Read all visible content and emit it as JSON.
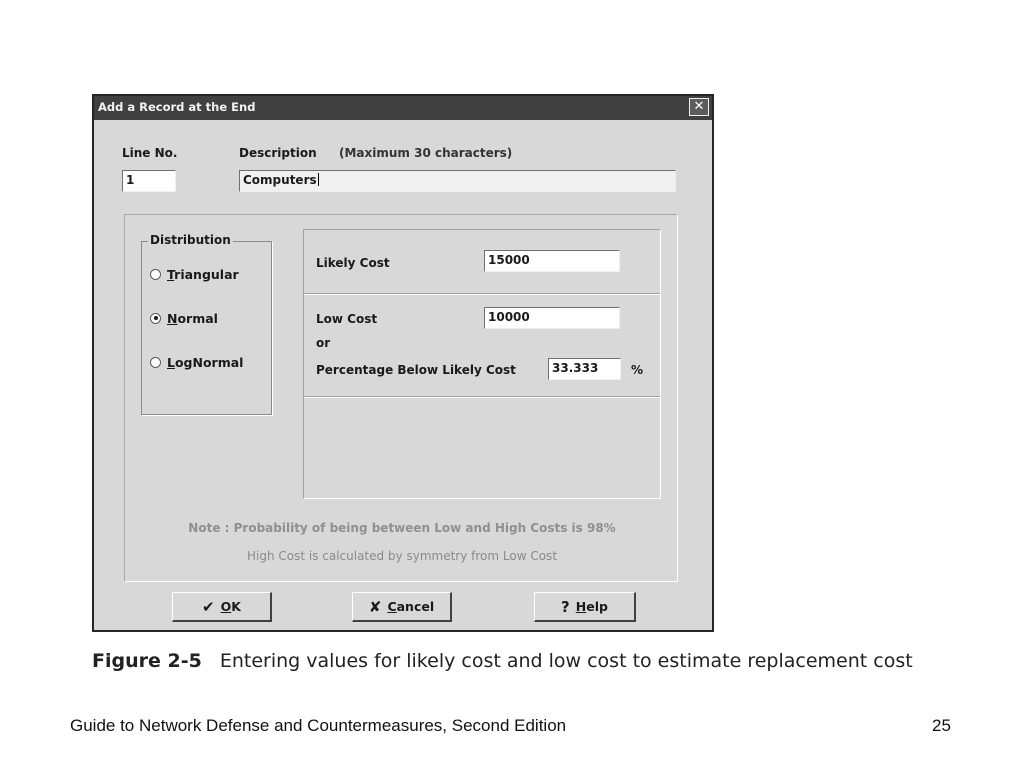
{
  "dialog": {
    "title": "Add a Record at the End",
    "close_glyph": "✕",
    "line_no_label": "Line No.",
    "line_no_value": "1",
    "description_label": "Description",
    "description_hint": "(Maximum 30 characters)",
    "description_value": "Computers"
  },
  "distribution": {
    "title": "Distribution",
    "options": [
      {
        "label": "Triangular",
        "mnemonic": "T",
        "rest": "riangular",
        "selected": false
      },
      {
        "label": "Normal",
        "mnemonic": "N",
        "rest": "ormal",
        "selected": true
      },
      {
        "label": "LogNormal",
        "mnemonic": "L",
        "rest": "ogNormal",
        "selected": false
      }
    ]
  },
  "costs": {
    "likely_label": "Likely Cost",
    "likely_value": "15000",
    "low_label": "Low Cost",
    "low_value": "10000",
    "or_label": "or",
    "pct_label": "Percentage Below Likely Cost",
    "pct_value": "33.333",
    "pct_unit": "%"
  },
  "notes": {
    "line1": "Note : Probability of being between Low and High Costs is 98%",
    "line2": "High Cost is calculated by symmetry from Low Cost"
  },
  "buttons": {
    "ok": {
      "icon": "checkmark-icon",
      "glyph": "✔",
      "mnemonic": "O",
      "rest": "K"
    },
    "cancel": {
      "icon": "x-icon",
      "glyph": "✘",
      "mnemonic": "C",
      "rest": "ancel"
    },
    "help": {
      "icon": "question-icon",
      "glyph": "?",
      "mnemonic": "H",
      "rest": "elp"
    }
  },
  "caption": {
    "label": "Figure 2-5",
    "text": "Entering values for likely cost and low cost to estimate replacement cost"
  },
  "footer": {
    "book_title": "Guide to Network Defense and Countermeasures, Second Edition",
    "page_number": "25"
  }
}
